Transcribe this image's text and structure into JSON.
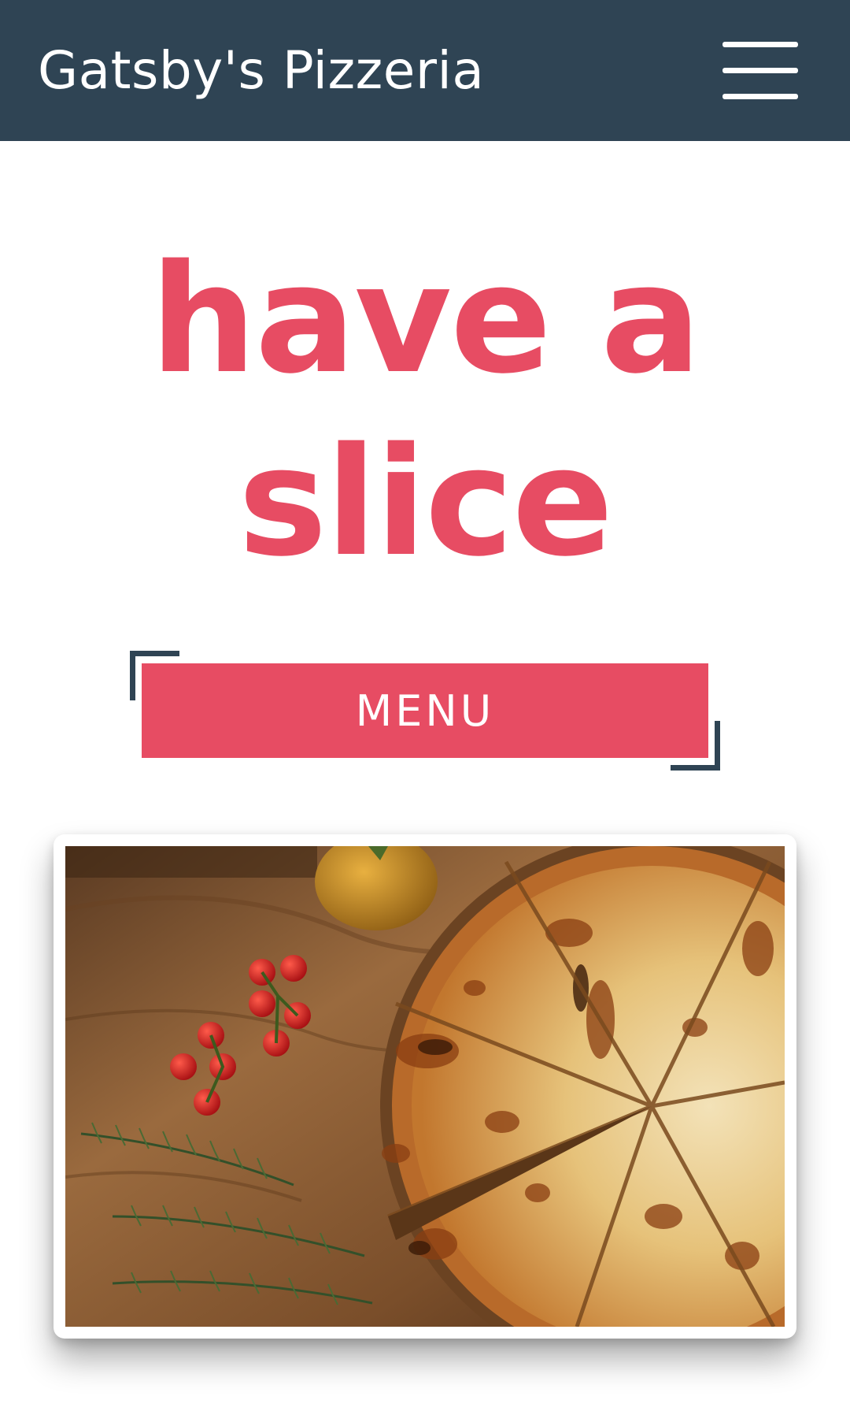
{
  "header": {
    "brand": "Gatsby's Pizzeria",
    "menu_icon": "hamburger-menu-icon"
  },
  "hero": {
    "title_line1": "have a",
    "title_line2": "slice"
  },
  "menu_button": {
    "label": "MENU"
  },
  "photo": {
    "subject": "pizza-photo"
  },
  "colors": {
    "navbar": "#2f4454",
    "accent": "#e74c63",
    "background": "#ffffff"
  }
}
